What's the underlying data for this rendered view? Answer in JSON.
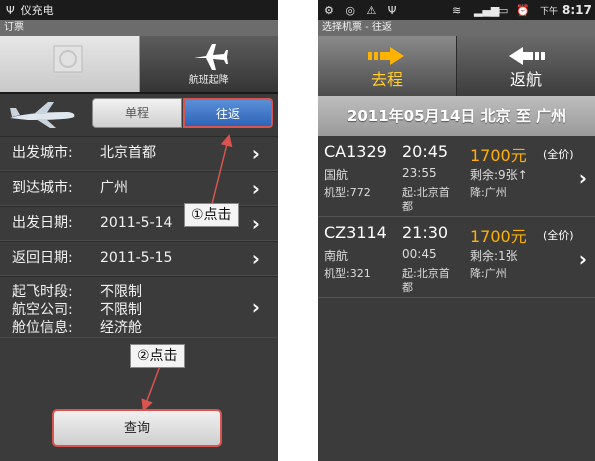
{
  "left": {
    "status": {
      "app": "仪充电"
    },
    "title": "订票",
    "tabs": [
      {
        "label": ""
      },
      {
        "label": "航班起降"
      }
    ],
    "trip": {
      "oneway": "单程",
      "round": "往返"
    },
    "rows": [
      {
        "label": "出发城市:",
        "value": "北京首都"
      },
      {
        "label": "到达城市:",
        "value": "广州"
      },
      {
        "label": "出发日期:",
        "value": "2011-5-14"
      },
      {
        "label": "返回日期:",
        "value": "2011-5-15"
      }
    ],
    "options": [
      {
        "label": "起飞时段:",
        "value": "不限制"
      },
      {
        "label": "航空公司:",
        "value": "不限制"
      },
      {
        "label": "舱位信息:",
        "value": "经济舱"
      }
    ],
    "callout1": "①点击",
    "callout2": "②点击",
    "query": "查询"
  },
  "right": {
    "status": {
      "time_label": "下午",
      "time": "8:17"
    },
    "title": "选择机票 - 往返",
    "tabs": {
      "outbound": "去程",
      "return": "返航"
    },
    "route": "2011年05月14日 北京 至 广州",
    "flights": [
      {
        "no": "CA1329",
        "dep": "20:45",
        "price": "1700元",
        "disc": "(全价)",
        "airline": "国航",
        "arr": "23:55",
        "seats": "剩余:9张↑",
        "model": "机型:772",
        "from": "起:北京首",
        "from2": "都",
        "to": "降:广州"
      },
      {
        "no": "CZ3114",
        "dep": "21:30",
        "price": "1700元",
        "disc": "(全价)",
        "airline": "南航",
        "arr": "00:45",
        "seats": "剩余:1张",
        "model": "机型:321",
        "from": "起:北京首",
        "from2": "都",
        "to": "降:广州"
      }
    ]
  }
}
